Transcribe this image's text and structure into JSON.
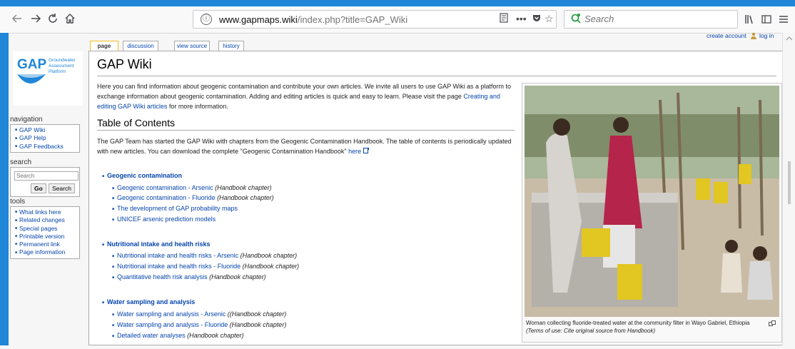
{
  "browser": {
    "url_host": "www.gapmaps.wiki",
    "url_path": "/index.php?title=GAP_Wiki",
    "search_placeholder": "Search",
    "info_icon": "ⓘ",
    "reader_icon": "reader-view-icon",
    "more_icon": "•••",
    "pocket_icon": "pocket-icon",
    "bookmark_icon": "☆"
  },
  "personal": {
    "create_account": "create account",
    "log_in": "log in"
  },
  "logo": {
    "letters": "GAP",
    "line1": "Groundwater",
    "line2": "Assessment",
    "line3": "Platform"
  },
  "sidebar": {
    "navigation_title": "navigation",
    "navigation_items": [
      "GAP Wiki",
      "GAP Help",
      "GAP Feedbacks"
    ],
    "search_title": "search",
    "search_placeholder": "Search",
    "go_label": "Go",
    "search_label": "Search",
    "tools_title": "tools",
    "tools_items": [
      "What links here",
      "Related changes",
      "Special pages",
      "Printable version",
      "Permanent link",
      "Page information"
    ]
  },
  "tabs": [
    "page",
    "discussion",
    "view source",
    "history"
  ],
  "page": {
    "title": "GAP Wiki",
    "intro_text": "Here you can find information about geogenic contamination and contribute your own articles. We invite all users to use GAP Wiki as a platform to exchange information about geogenic contamination. Adding and editing articles is quick and easy to learn. Please visit the page ",
    "intro_link": "Creating and editing GAP Wiki articles",
    "intro_end": " for more information.",
    "toc_heading": "Table of Contents",
    "toc_text": "The GAP Team has started the GAP Wiki with chapters from the Geogenic Contamination Handbook. The table of contents is periodically updated with new articles. You can download the complete \"Geogenic Contamination Handbook\" ",
    "toc_link": "here",
    "sections": [
      {
        "title": "Geogenic contamination",
        "items": [
          {
            "link": "Geogenic contamination - Arsenic",
            "note": " (Handbook chapter)"
          },
          {
            "link": "Geogenic contamination - Fluoride",
            "note": " (Handbook chapter)"
          },
          {
            "link": "The development of GAP probability maps",
            "note": ""
          },
          {
            "link": "UNICEF arsenic prediction models",
            "note": ""
          }
        ]
      },
      {
        "title": "Nutritional intake and health risks",
        "items": [
          {
            "link": "Nutritional intake and health risks - Arsenic",
            "note": " (Handbook chapter)"
          },
          {
            "link": "Nutritional intake and health risks - Fluoride",
            "note": " (Handbook chapter)"
          },
          {
            "link": "Quantitative health risk analysis",
            "note": " (Handbook chapter)"
          }
        ]
      },
      {
        "title": "Water sampling and analysis",
        "items": [
          {
            "link": "Water sampling and analysis - Arsenic",
            "note": " ((Handbook chapter)"
          },
          {
            "link": "Water sampling and analysis - Fluoride",
            "note": " (Handbook chapter)"
          },
          {
            "link": "Detailed water analyses",
            "note": " (Handbook chapter)"
          }
        ]
      }
    ],
    "caption": "Woman collecting fluoride-treated water at the community filter in Wayo Gabriel, Ethiopia",
    "caption_terms": "(Terms of use: Cite original source from Handbook)"
  },
  "colors": {
    "accent": "#1f86d8",
    "link": "#0645ad",
    "selected_tab": "#fabd23"
  }
}
